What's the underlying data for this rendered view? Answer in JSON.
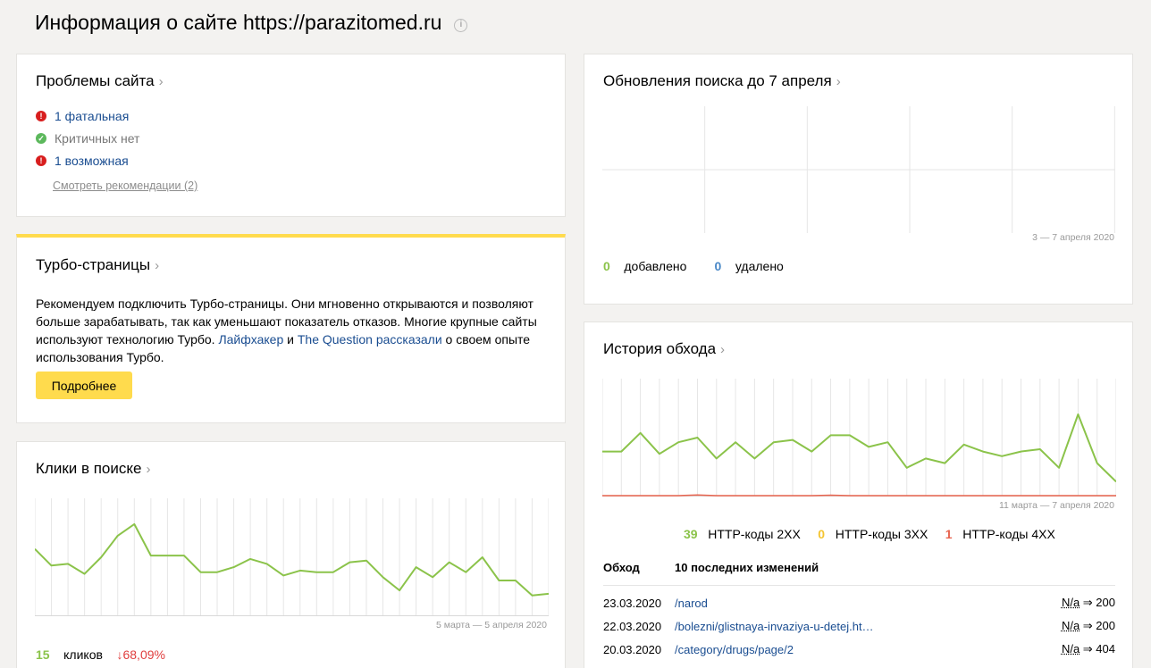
{
  "page": {
    "title": "Информация о сайте https://parazitomed.ru"
  },
  "problems": {
    "title": "Проблемы сайта",
    "items": [
      {
        "status": "error",
        "text": "1 фатальная",
        "link": true
      },
      {
        "status": "ok",
        "text": "Критичных нет",
        "link": false
      },
      {
        "status": "error",
        "text": "1 возможная",
        "link": true
      }
    ],
    "recommendations_link": "Смотреть рекомендации (2)"
  },
  "turbo": {
    "title": "Турбо-страницы",
    "text_1": "Рекомендуем подключить Турбо-страницы. Они мгновенно открываются и позволяют больше зарабатывать, так как уменьшают показатель отказов. Многие крупные сайты используют технологию Турбо. ",
    "link_1": "Лайфхакер",
    "text_2": " и ",
    "link_2": "The Question",
    "link_3": "рассказали",
    "text_3": " о своем опыте использования Турбо.",
    "button": "Подробнее",
    "accent_color": "#ffdb4d"
  },
  "clicks": {
    "title": "Клики в поиске",
    "range": "5 марта — 5 апреля 2020",
    "count": "15",
    "count_label": "кликов",
    "change": "↓68,09%"
  },
  "updates": {
    "title": "Обновления поиска до 7 апреля",
    "range": "3 — 7 апреля 2020",
    "added_count": "0",
    "added_label": "добавлено",
    "removed_count": "0",
    "removed_label": "удалено"
  },
  "crawl": {
    "title": "История обхода",
    "range": "11 марта — 7 апреля 2020",
    "legend": [
      {
        "count": "39",
        "label": "HTTP-коды 2XX"
      },
      {
        "count": "0",
        "label": "HTTP-коды 3XX"
      },
      {
        "count": "1",
        "label": "HTTP-коды 4XX"
      }
    ],
    "col_header_1": "Обход",
    "col_header_2": "10 последних изменений",
    "changes": [
      {
        "date": "23.03.2020",
        "url": "/narod",
        "from": "N/a",
        "to": "200"
      },
      {
        "date": "22.03.2020",
        "url": "/bolezni/glistnaya-invaziya-u-detej.ht…",
        "from": "N/a",
        "to": "200"
      },
      {
        "date": "20.03.2020",
        "url": "/category/drugs/page/2",
        "from": "N/a",
        "to": "404"
      }
    ]
  },
  "chart_data": [
    {
      "type": "line",
      "title": "Клики в поиске",
      "x_range": "5 марта — 5 апреля 2020",
      "series": [
        {
          "values": [
            4,
            3,
            3.1,
            2.5,
            3.5,
            4.8,
            5.5,
            3.6,
            3.6,
            3.6,
            2.6,
            2.6,
            2.9,
            3.4,
            3.1,
            2.4,
            2.7,
            2.6,
            2.6,
            3.2,
            3.3,
            2.3,
            1.5,
            2.9,
            2.3,
            3.2,
            2.6,
            3.5,
            2.1,
            2.1,
            1.2,
            1.3
          ],
          "color": "#8bc34a"
        }
      ],
      "ylim": [
        0,
        7
      ]
    },
    {
      "type": "line",
      "title": "История обхода",
      "x_range": "11 марта — 7 апреля 2020",
      "series": [
        {
          "name": "HTTP-коды 2XX",
          "values": [
            19,
            19,
            27,
            18,
            23,
            25,
            16,
            23,
            16,
            23,
            24,
            19,
            26,
            26,
            21,
            23,
            12,
            16,
            14,
            22,
            19,
            17,
            19,
            20,
            12,
            35,
            14,
            6
          ],
          "color": "#8bc34a"
        },
        {
          "name": "HTTP-коды 4XX",
          "values": [
            0,
            0,
            0,
            0,
            0,
            0.3,
            0,
            0,
            0,
            0,
            0,
            0,
            0.2,
            0,
            0,
            0,
            0,
            0,
            0,
            0,
            0,
            0,
            0,
            0,
            0,
            0,
            0,
            0
          ],
          "color": "#e8644f"
        }
      ],
      "ylim": [
        0,
        50
      ]
    }
  ]
}
